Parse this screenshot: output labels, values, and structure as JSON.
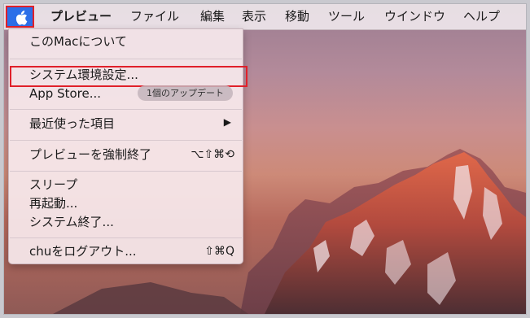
{
  "menubar": {
    "apple_icon": "apple-logo-icon",
    "items": [
      "プレビュー",
      "ファイル",
      "編集",
      "表示",
      "移動",
      "ツール",
      "ウインドウ",
      "ヘルプ"
    ]
  },
  "apple_menu": {
    "about": "このMacについて",
    "system_prefs": "システム環境設定...",
    "app_store": "App Store...",
    "app_store_badge": "1個のアップデート",
    "recent_items": "最近使った項目",
    "submenu_arrow": "▶",
    "force_quit": "プレビューを強制終了",
    "force_quit_shortcut": "⌥⇧⌘⟲",
    "sleep": "スリープ",
    "restart": "再起動...",
    "shutdown": "システム終了...",
    "logout": "chuをログアウト...",
    "logout_shortcut": "⇧⌘Q"
  },
  "colors": {
    "highlight_border": "#e0202a",
    "apple_selected_bg": "#2c6fe8"
  }
}
